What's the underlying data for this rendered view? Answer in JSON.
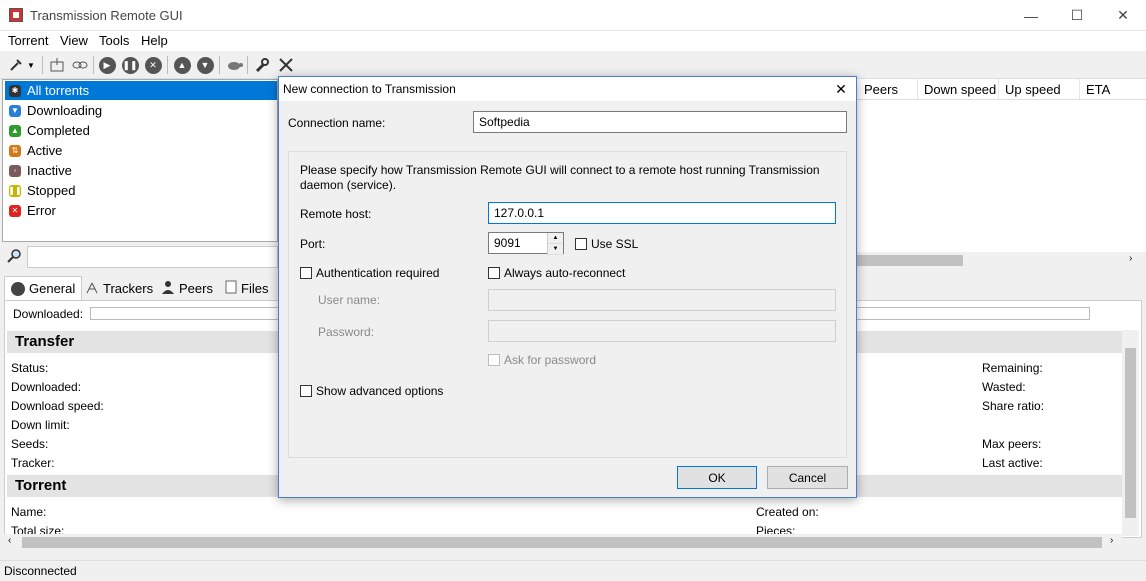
{
  "window": {
    "title": "Transmission Remote GUI",
    "minimize": "—",
    "maximize": "☐",
    "close": "✕"
  },
  "menu": [
    "Torrent",
    "View",
    "Tools",
    "Help"
  ],
  "filters": [
    "All torrents",
    "Downloading",
    "Completed",
    "Active",
    "Inactive",
    "Stopped",
    "Error"
  ],
  "columns": [
    "Peers",
    "Down speed",
    "Up speed",
    "ETA"
  ],
  "tabs": [
    "General",
    "Trackers",
    "Peers",
    "Files"
  ],
  "general": {
    "downloaded_label": "Downloaded:",
    "transfer_title": "Transfer",
    "transfer_left": [
      "Status:",
      "Downloaded:",
      "Download speed:",
      "Down limit:",
      "Seeds:",
      "Tracker:"
    ],
    "transfer_right": [
      "Remaining:",
      "Wasted:",
      "Share ratio:",
      "",
      "Max peers:",
      "Last active:"
    ],
    "torrent_title": "Torrent",
    "torrent_left": [
      "Name:",
      "Total size:"
    ],
    "torrent_right": [
      "Created on:",
      "Pieces:"
    ]
  },
  "status": "Disconnected",
  "dialog": {
    "title": "New connection to Transmission",
    "close": "✕",
    "connection_name_label": "Connection name:",
    "connection_name_value": "Softpedia",
    "description": "Please specify how Transmission Remote GUI will connect to a remote host running Transmission daemon (service).",
    "remote_host_label": "Remote host:",
    "remote_host_value": "127.0.0.1",
    "port_label": "Port:",
    "port_value": "9091",
    "use_ssl_label": "Use SSL",
    "auth_label": "Authentication required",
    "auto_reconnect_label": "Always auto-reconnect",
    "username_label": "User name:",
    "password_label": "Password:",
    "ask_password_label": "Ask for password",
    "advanced_label": "Show advanced options",
    "ok": "OK",
    "cancel": "Cancel"
  },
  "colors": {
    "selection": "#0078d7",
    "dialog_border": "#4a7bd3"
  }
}
